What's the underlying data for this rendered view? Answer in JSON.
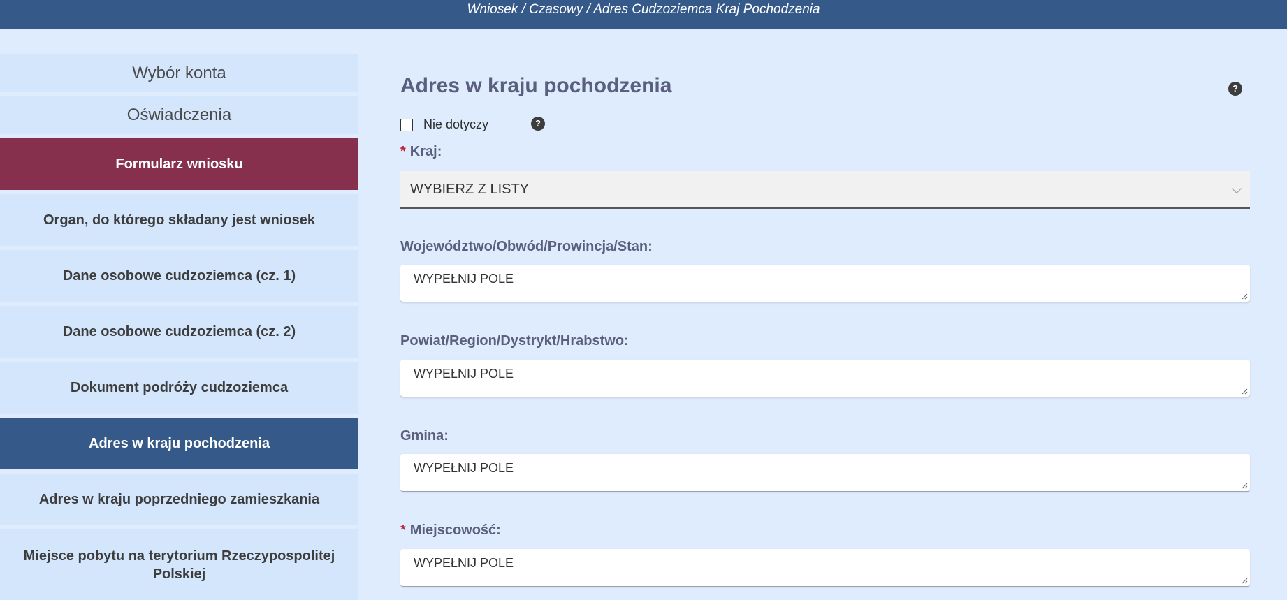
{
  "header": {
    "breadcrumb": "Wniosek / Czasowy / Adres Cudzoziemca Kraj Pochodzenia"
  },
  "sidebar": {
    "items": [
      {
        "label": "Wybór konta"
      },
      {
        "label": "Oświadczenia"
      },
      {
        "label": "Formularz wniosku"
      },
      {
        "label": "Organ, do którego składany jest wniosek"
      },
      {
        "label": "Dane osobowe cudzoziemca (cz. 1)"
      },
      {
        "label": "Dane osobowe cudzoziemca (cz. 2)"
      },
      {
        "label": "Dokument podróży cudzoziemca"
      },
      {
        "label": "Adres w kraju pochodzenia"
      },
      {
        "label": "Adres w kraju poprzedniego zamieszkania"
      },
      {
        "label": "Miejsce pobytu na terytorium Rzeczypospolitej Polskiej"
      }
    ]
  },
  "form": {
    "title": "Adres w kraju pochodzenia",
    "help_glyph": "?",
    "not_applicable_label": "Nie dotyczy",
    "required_mark": "*",
    "country_label": "Kraj:",
    "country_value": "WYBIERZ Z LISTY",
    "fields": [
      {
        "label": "Województwo/Obwód/Prowincja/Stan:",
        "value": "WYPEŁNIJ POLE"
      },
      {
        "label": "Powiat/Region/Dystrykt/Hrabstwo:",
        "value": "WYPEŁNIJ POLE"
      },
      {
        "label": "Gmina:",
        "value": "WYPEŁNIJ POLE"
      },
      {
        "label": "Miejscowość:",
        "value": "WYPEŁNIJ POLE"
      }
    ]
  },
  "colors": {
    "header_bg": "#355a8a",
    "active_form_bg": "#87304d",
    "current_step_bg": "#355a8a",
    "required": "#c0213a"
  }
}
